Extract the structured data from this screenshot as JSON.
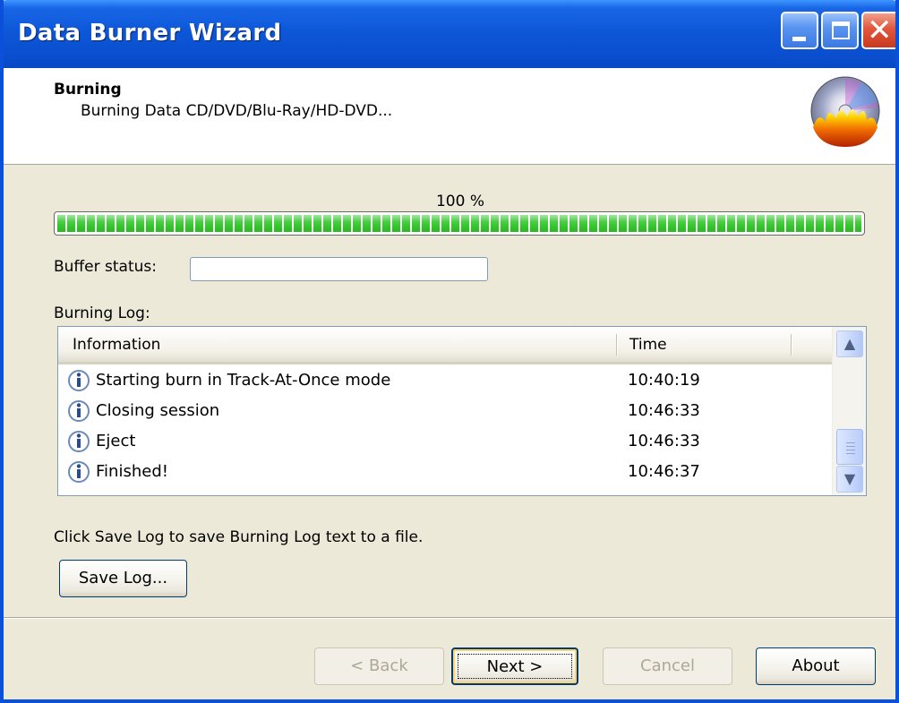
{
  "window": {
    "title": "Data Burner Wizard"
  },
  "header": {
    "title": "Burning",
    "subtitle": "Burning Data CD/DVD/Blu-Ray/HD-DVD...",
    "icon": "cd-burn-icon"
  },
  "progress": {
    "label": "100 %",
    "value": 1.0,
    "color": "#37c82f"
  },
  "buffer": {
    "label": "Buffer status:",
    "value": ""
  },
  "log": {
    "label": "Burning Log:",
    "columns": [
      "Information",
      "Time"
    ],
    "rows": [
      {
        "icon": "info-icon",
        "info": "Starting burn in Track-At-Once mode",
        "time": "10:40:19"
      },
      {
        "icon": "info-icon",
        "info": "Closing session",
        "time": "10:46:33"
      },
      {
        "icon": "info-icon",
        "info": "Eject",
        "time": "10:46:33"
      },
      {
        "icon": "info-icon",
        "info": "Finished!",
        "time": "10:46:37"
      }
    ]
  },
  "hint": "Click Save Log to save Burning Log text to a file.",
  "buttons": {
    "save_log": "Save Log...",
    "back": "< Back",
    "next": "Next >",
    "cancel": "Cancel",
    "about": "About"
  },
  "colors": {
    "titlebar": "#0a4fd0",
    "face": "#ece9d8",
    "progress": "#37c82f"
  }
}
